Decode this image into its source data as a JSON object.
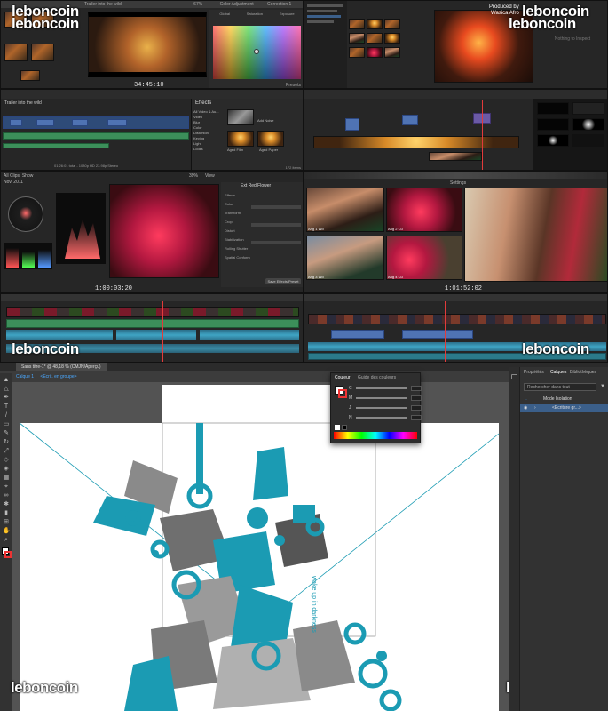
{
  "watermark": {
    "brand": "leboncoin"
  },
  "viewer_top": {
    "title": "Trailer into the wild",
    "zoom": "67%",
    "panel_right": "Color Adjustment",
    "panel_right_extra": "Correction 1",
    "labels": [
      "Global",
      "Saturation",
      "Exposure"
    ],
    "timecode": "34:45:10",
    "footer_label": "Presets"
  },
  "viewer_right": {
    "credit_line1": "Produced by",
    "credit_line2": "Wasica Afro",
    "inspector_empty": "Nothing to Inspect"
  },
  "timeline_left": {
    "title": "Trailer into the wild",
    "effects_title": "Effects",
    "effects_categories": [
      "All Video & Au...",
      "Video",
      "Blur",
      "Color",
      "Distortion",
      "Keying",
      "Light",
      "Looks"
    ],
    "effects_items": [
      "Add Noise",
      "Aged Film",
      "Aged Paper"
    ],
    "status": "01:26:01 total - 1080p HD 23.98p Stereo",
    "item_count": "172 items"
  },
  "scopes": {
    "library_label": "All Clips, Show",
    "date_label": "Nov. 2011",
    "zoom": "39%",
    "view_label": "View",
    "scope_labels": [
      "RGB Parade",
      "Vectorscope"
    ],
    "timecode": "1:00:03:20",
    "inspector_title": "Ext Red Flower",
    "inspector_rows": [
      "Effects",
      "Color",
      "Transform",
      "Crop",
      "Distort",
      "Stabilization",
      "Rolling Shutter",
      "Spatial Conform"
    ],
    "inspector_button": "Save Effects Preset"
  },
  "multicam": {
    "settings_label": "Settings",
    "angle_labels": [
      "Ang 1 Wd",
      "Ang 2 Cu",
      "Ang 3 Wd",
      "Ang 4 Cu"
    ],
    "timecode": "1:01:52:02"
  },
  "illustrator": {
    "doc_tab": "Sans titre-1* @ 48,18 % (CMJN/Aperçu)",
    "breadcrumb_layer": "Calque 1",
    "breadcrumb_group": "<Ecriture>",
    "breadcrumb_group2": "<Ecrit. en groupe>",
    "vertical_text": "wake up in darkness"
  },
  "color_panel": {
    "tab_color": "Couleur",
    "tab_guide": "Guide des couleurs",
    "channels": [
      {
        "label": "C",
        "value": ""
      },
      {
        "label": "M",
        "value": ""
      },
      {
        "label": "J",
        "value": ""
      },
      {
        "label": "N",
        "value": ""
      }
    ],
    "percent": "%"
  },
  "layers_panel": {
    "tabs": [
      "Propriétés",
      "Calques",
      "Bibliothèques"
    ],
    "search_placeholder": "Rechercher dans tout",
    "rows": [
      {
        "label": "Mode Isolation"
      },
      {
        "label": "<Ecriture gr...>"
      }
    ]
  },
  "colors": {
    "accent_teal": "#1b9bb3",
    "fcp_blue_clip": "#4f73b3",
    "fcp_green_clip": "#3c8f5a",
    "ai_selection": "#3b5f8a"
  }
}
